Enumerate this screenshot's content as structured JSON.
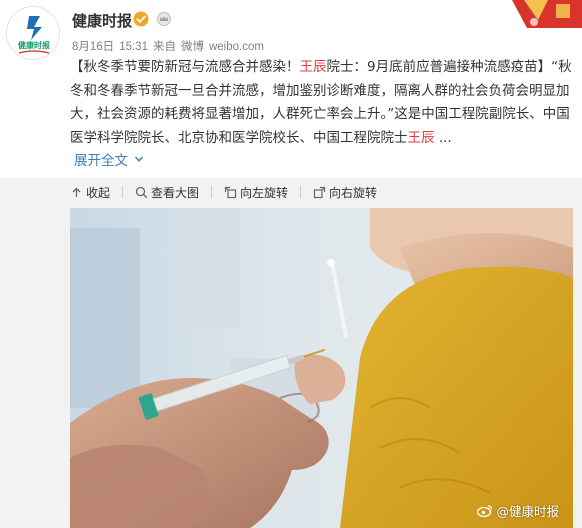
{
  "post": {
    "author": "健康时报",
    "avatar_text": "健康时报",
    "meta": {
      "date": "8月16日",
      "time": "15:31",
      "source_prefix": "来自",
      "source": "微博",
      "domain": "weibo.com"
    },
    "text": {
      "title_pre": "【秋冬季节要防新冠与流感合并感染！",
      "title_name": "王辰",
      "title_post": "院士：9月底前应普遍接种流感疫苗】",
      "body_1": "“秋冬和冬春季节新冠一旦合并流感，增加鉴别诊断难度，隔离人群的社会负荷会明显加大，社会资源的耗费将显著增加，人群死亡率会上升。”这是中国工程院副院长、中国医学科学院院长、北京协和医学院校长、中国工程院院士",
      "body_name": "王辰",
      "ellipsis": " ..."
    },
    "expand_label": "展开全文"
  },
  "media_toolbar": {
    "collapse": "收起",
    "view_large": "查看大图",
    "rotate_left": "向左旋转",
    "rotate_right": "向右旋转"
  },
  "watermark": "@健康时报",
  "icons": {
    "verified": "verified-badge-icon",
    "member": "crown-icon",
    "collapse": "arrow-up-icon",
    "view_large": "magnifier-icon",
    "rotate_left": "rotate-left-icon",
    "rotate_right": "rotate-right-icon",
    "expand": "chevron-down-icon",
    "weibo": "weibo-logo-icon"
  },
  "colors": {
    "link": "#3a7fbd",
    "highlight": "#e4393c",
    "verified": "#f5a623",
    "media_bg": "#f2f2f2"
  }
}
